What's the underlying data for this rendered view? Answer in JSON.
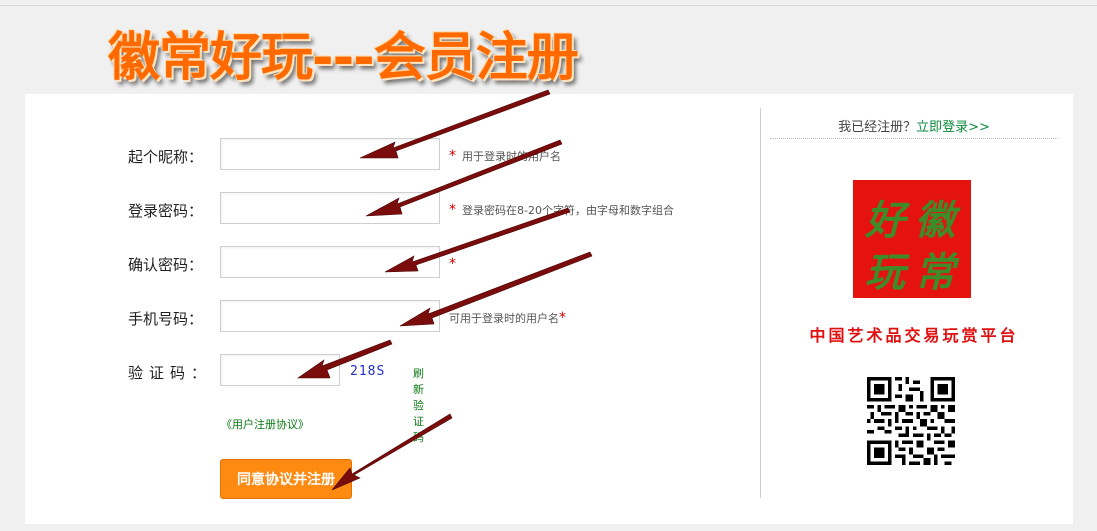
{
  "banner": {
    "title": "徽常好玩---会员注册"
  },
  "form": {
    "nickname": {
      "label": "起个昵称：",
      "value": "",
      "hint": "用于登录时的用户名"
    },
    "password": {
      "label": "登录密码：",
      "value": "",
      "hint": "登录密码在8-20个字符，由字母和数字组合"
    },
    "confirm": {
      "label": "确认密码：",
      "value": ""
    },
    "phone": {
      "label": "手机号码：",
      "value": "",
      "hint": "可用于登录时的用户名"
    },
    "captcha": {
      "label": "验证码：",
      "value": "",
      "code": "218S",
      "refresh": "刷新验证码"
    },
    "required_mark": "*",
    "agreement": "《用户注册协议》",
    "submit": "同意协议并注册"
  },
  "sidebar": {
    "already_registered": "我已经注册？",
    "login_link": "立即登录>>",
    "logo_chars": [
      "徽",
      "常",
      "好",
      "玩"
    ],
    "tagline": "中国艺术品交易玩赏平台",
    "qr_icon": "qr-code-icon"
  },
  "colors": {
    "banner": "#ff6a00",
    "submit": "#ff8a12",
    "required": "#d40000",
    "link_green": "#0a7a14",
    "captcha_blue": "#2030c8",
    "logo_bg": "#e5130f",
    "tagline": "#e01010",
    "arrow": "#7a0c0c"
  }
}
